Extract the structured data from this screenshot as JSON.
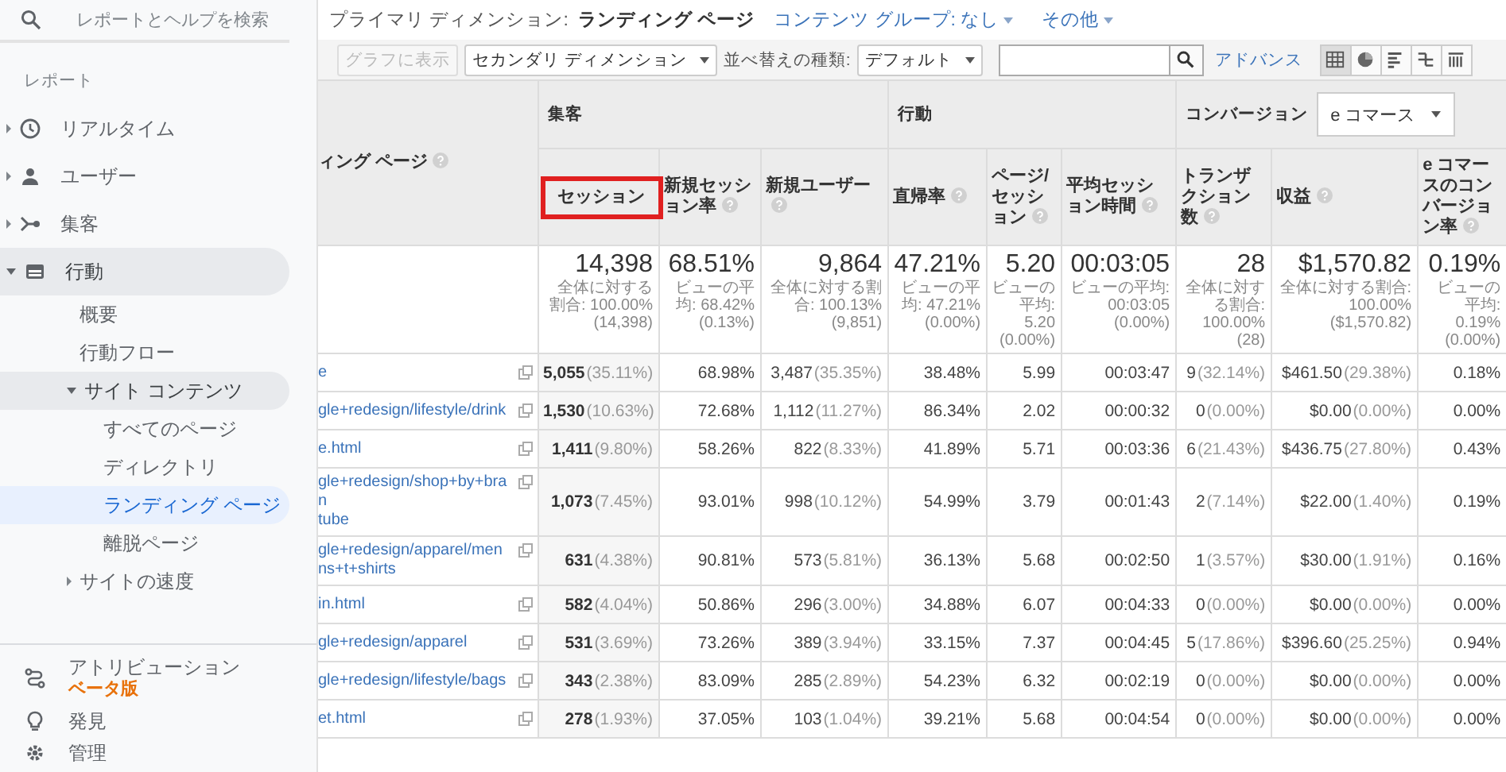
{
  "sidebar": {
    "search": {
      "placeholder": "レポートとヘルプを検索"
    },
    "section_label": "レポート",
    "nav": [
      {
        "label": "リアルタイム",
        "expanded": false,
        "selected": false
      },
      {
        "label": "ユーザー",
        "expanded": false,
        "selected": false
      },
      {
        "label": "集客",
        "expanded": false,
        "selected": false
      },
      {
        "label": "行動",
        "expanded": true,
        "selected": false,
        "children": [
          {
            "label": "概要",
            "selected": false
          },
          {
            "label": "行動フロー",
            "selected": false
          },
          {
            "label": "サイト コンテンツ",
            "expanded": true,
            "selected": false,
            "children": [
              {
                "label": "すべてのページ",
                "selected": false
              },
              {
                "label": "ディレクトリ",
                "selected": false
              },
              {
                "label": "ランディング ページ",
                "selected": true
              },
              {
                "label": "離脱ページ",
                "selected": false
              }
            ]
          },
          {
            "label": "サイトの速度",
            "expanded": false,
            "selected": false
          }
        ]
      }
    ],
    "bottom": [
      {
        "label": "アトリビューション",
        "badge": "ベータ版",
        "selected": false
      },
      {
        "label": "発見",
        "selected": false
      },
      {
        "label": "管理",
        "selected": false
      }
    ]
  },
  "report": {
    "primary_dimension_label": "プライマリ ディメンション:",
    "primary_dimension": "ランディング ページ",
    "content_group": "コンテンツ グループ: なし",
    "more": "その他"
  },
  "toolbar": {
    "chart_button": {
      "label": "グラフに表示",
      "disabled": true
    },
    "secondary_dimension": "セカンダリ ディメンション",
    "sort_label": "並べ替えの種類:",
    "sort_type": "デフォルト",
    "advanced": "アドバンス",
    "view_modes": [
      {
        "selected": true
      },
      {
        "selected": false
      },
      {
        "selected": false
      },
      {
        "selected": false
      },
      {
        "selected": false
      }
    ]
  },
  "table": {
    "dimension_header": "ィング ページ",
    "groups": [
      {
        "label": "集客",
        "columns": [
          {
            "label": "セッション",
            "help": false,
            "sorted": true,
            "highlighted": true
          },
          {
            "label": "新規セッション率",
            "help": true,
            "sorted": false,
            "highlighted": false
          },
          {
            "label": "新規ユーザー",
            "help": true,
            "sorted": false,
            "highlighted": false
          }
        ]
      },
      {
        "label": "行動",
        "columns": [
          {
            "label": "直帰率",
            "help": true,
            "sorted": false,
            "highlighted": false
          },
          {
            "label": "ページ/セッション",
            "help": true,
            "sorted": false,
            "highlighted": false
          },
          {
            "label": "平均セッション時間",
            "help": true,
            "sorted": false,
            "highlighted": false
          }
        ]
      },
      {
        "label": "コンバージョン",
        "selector": "e コマース",
        "columns": [
          {
            "label": "トランザクション数",
            "help": true,
            "sorted": false,
            "highlighted": false
          },
          {
            "label": "収益",
            "help": true,
            "sorted": false,
            "highlighted": false
          },
          {
            "label": "e コマースのコンバージョン率",
            "help": true,
            "sorted": false,
            "highlighted": false
          }
        ]
      }
    ],
    "totals": [
      {
        "value": "14,398",
        "note": "全体に対する割合: 100.00% (14,398)"
      },
      {
        "value": "68.51%",
        "note": "ビューの平均: 68.42% (0.13%)"
      },
      {
        "value": "9,864",
        "note": "全体に対する割合: 100.13% (9,851)"
      },
      {
        "value": "47.21%",
        "note": "ビューの平均: 47.21% (0.00%)"
      },
      {
        "value": "5.20",
        "note": "ビューの平均: 5.20 (0.00%)"
      },
      {
        "value": "00:03:05",
        "note": "ビューの平均: 00:03:05 (0.00%)"
      },
      {
        "value": "28",
        "note": "全体に対する割合: 100.00% (28)"
      },
      {
        "value": "$1,570.82",
        "note": "全体に対する割合: 100.00% ($1,570.82)"
      },
      {
        "value": "0.19%",
        "note": "ビューの平均: 0.19% (0.00%)"
      }
    ],
    "rows": [
      {
        "page": "e",
        "cells": [
          {
            "value": "5,055",
            "share": "(35.11%)"
          },
          {
            "value": "68.98%"
          },
          {
            "value": "3,487",
            "share": "(35.35%)"
          },
          {
            "value": "38.48%"
          },
          {
            "value": "5.99"
          },
          {
            "value": "00:03:47"
          },
          {
            "value": "9",
            "share": "(32.14%)"
          },
          {
            "value": "$461.50",
            "share": "(29.38%)"
          },
          {
            "value": "0.18%"
          }
        ]
      },
      {
        "page": "gle+redesign/lifestyle/drink",
        "cells": [
          {
            "value": "1,530",
            "share": "(10.63%)"
          },
          {
            "value": "72.68%"
          },
          {
            "value": "1,112",
            "share": "(11.27%)"
          },
          {
            "value": "86.34%"
          },
          {
            "value": "2.02"
          },
          {
            "value": "00:00:32"
          },
          {
            "value": "0",
            "share": "(0.00%)"
          },
          {
            "value": "$0.00",
            "share": "(0.00%)"
          },
          {
            "value": "0.00%"
          }
        ]
      },
      {
        "page": "e.html",
        "cells": [
          {
            "value": "1,411",
            "share": "(9.80%)"
          },
          {
            "value": "58.26%"
          },
          {
            "value": "822",
            "share": "(8.33%)"
          },
          {
            "value": "41.89%"
          },
          {
            "value": "5.71"
          },
          {
            "value": "00:03:36"
          },
          {
            "value": "6",
            "share": "(21.43%)"
          },
          {
            "value": "$436.75",
            "share": "(27.80%)"
          },
          {
            "value": "0.43%"
          }
        ]
      },
      {
        "page": "gle+redesign/shop+by+bran\ntube",
        "cells": [
          {
            "value": "1,073",
            "share": "(7.45%)"
          },
          {
            "value": "93.01%"
          },
          {
            "value": "998",
            "share": "(10.12%)"
          },
          {
            "value": "54.99%"
          },
          {
            "value": "3.79"
          },
          {
            "value": "00:01:43"
          },
          {
            "value": "2",
            "share": "(7.14%)"
          },
          {
            "value": "$22.00",
            "share": "(1.40%)"
          },
          {
            "value": "0.19%"
          }
        ]
      },
      {
        "page": "gle+redesign/apparel/men\nns+t+shirts",
        "cells": [
          {
            "value": "631",
            "share": "(4.38%)"
          },
          {
            "value": "90.81%"
          },
          {
            "value": "573",
            "share": "(5.81%)"
          },
          {
            "value": "36.13%"
          },
          {
            "value": "5.68"
          },
          {
            "value": "00:02:50"
          },
          {
            "value": "1",
            "share": "(3.57%)"
          },
          {
            "value": "$30.00",
            "share": "(1.91%)"
          },
          {
            "value": "0.16%"
          }
        ]
      },
      {
        "page": "in.html",
        "cells": [
          {
            "value": "582",
            "share": "(4.04%)"
          },
          {
            "value": "50.86%"
          },
          {
            "value": "296",
            "share": "(3.00%)"
          },
          {
            "value": "34.88%"
          },
          {
            "value": "6.07"
          },
          {
            "value": "00:04:33"
          },
          {
            "value": "0",
            "share": "(0.00%)"
          },
          {
            "value": "$0.00",
            "share": "(0.00%)"
          },
          {
            "value": "0.00%"
          }
        ]
      },
      {
        "page": "gle+redesign/apparel",
        "cells": [
          {
            "value": "531",
            "share": "(3.69%)"
          },
          {
            "value": "73.26%"
          },
          {
            "value": "389",
            "share": "(3.94%)"
          },
          {
            "value": "33.15%"
          },
          {
            "value": "7.37"
          },
          {
            "value": "00:04:45"
          },
          {
            "value": "5",
            "share": "(17.86%)"
          },
          {
            "value": "$396.60",
            "share": "(25.25%)"
          },
          {
            "value": "0.94%"
          }
        ]
      },
      {
        "page": "gle+redesign/lifestyle/bags",
        "cells": [
          {
            "value": "343",
            "share": "(2.38%)"
          },
          {
            "value": "83.09%"
          },
          {
            "value": "285",
            "share": "(2.89%)"
          },
          {
            "value": "54.23%"
          },
          {
            "value": "6.32"
          },
          {
            "value": "00:02:19"
          },
          {
            "value": "0",
            "share": "(0.00%)"
          },
          {
            "value": "$0.00",
            "share": "(0.00%)"
          },
          {
            "value": "0.00%"
          }
        ]
      },
      {
        "page": "et.html",
        "cells": [
          {
            "value": "278",
            "share": "(1.93%)"
          },
          {
            "value": "37.05%"
          },
          {
            "value": "103",
            "share": "(1.04%)"
          },
          {
            "value": "39.21%"
          },
          {
            "value": "5.68"
          },
          {
            "value": "00:04:54"
          },
          {
            "value": "0",
            "share": "(0.00%)"
          },
          {
            "value": "$0.00",
            "share": "(0.00%)"
          },
          {
            "value": "0.00%"
          }
        ]
      }
    ]
  }
}
